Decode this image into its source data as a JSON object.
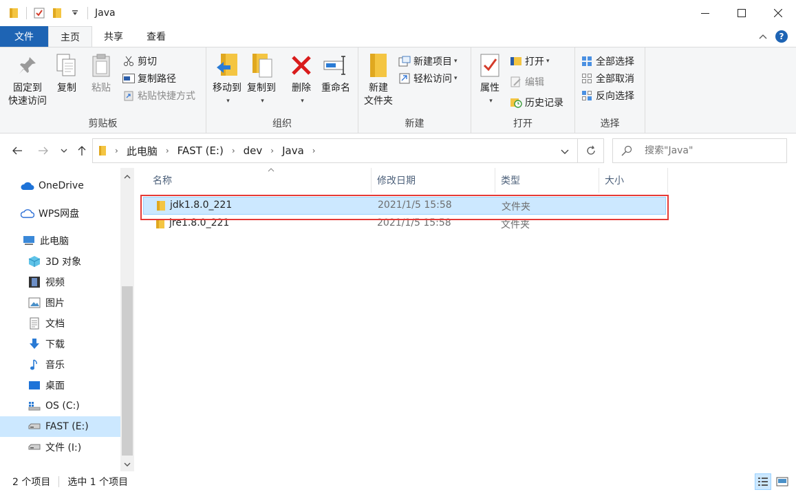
{
  "window": {
    "title": "Java"
  },
  "tabs": [
    {
      "label": "文件"
    },
    {
      "label": "主页"
    },
    {
      "label": "共享"
    },
    {
      "label": "查看"
    }
  ],
  "ribbon": {
    "clipboard": {
      "label": "剪贴板",
      "pin": "固定到\n快速访问",
      "copy": "复制",
      "paste": "粘贴",
      "cut": "剪切",
      "copy_path": "复制路径",
      "paste_shortcut": "粘贴快捷方式"
    },
    "organize": {
      "label": "组织",
      "move_to": "移动到",
      "copy_to": "复制到",
      "delete": "删除",
      "rename": "重命名"
    },
    "new": {
      "label": "新建",
      "new_folder": "新建\n文件夹",
      "new_item": "新建项目",
      "easy_access": "轻松访问"
    },
    "open": {
      "label": "打开",
      "properties": "属性",
      "open": "打开",
      "edit": "编辑",
      "history": "历史记录"
    },
    "select": {
      "label": "选择",
      "select_all": "全部选择",
      "select_none": "全部取消",
      "invert": "反向选择"
    }
  },
  "address": {
    "crumbs": [
      "此电脑",
      "FAST (E:)",
      "dev",
      "Java"
    ],
    "search_placeholder": "搜索\"Java\""
  },
  "nav": [
    {
      "label": "OneDrive",
      "icon": "cloud-icon"
    },
    {
      "label": "WPS网盘",
      "icon": "cloud-outline-icon"
    },
    {
      "label": "此电脑",
      "icon": "computer-icon"
    },
    {
      "label": "3D 对象",
      "icon": "cube-icon"
    },
    {
      "label": "视频",
      "icon": "film-icon"
    },
    {
      "label": "图片",
      "icon": "picture-icon"
    },
    {
      "label": "文档",
      "icon": "document-icon"
    },
    {
      "label": "下载",
      "icon": "download-icon"
    },
    {
      "label": "音乐",
      "icon": "music-icon"
    },
    {
      "label": "桌面",
      "icon": "desktop-icon"
    },
    {
      "label": "OS (C:)",
      "icon": "os-drive-icon"
    },
    {
      "label": "FAST (E:)",
      "icon": "drive-icon"
    },
    {
      "label": "文件 (I:)",
      "icon": "drive-icon"
    }
  ],
  "columns": {
    "name": "名称",
    "date": "修改日期",
    "type": "类型",
    "size": "大小"
  },
  "files": [
    {
      "name": "jdk1.8.0_221",
      "date": "2021/1/5 15:58",
      "type": "文件夹"
    },
    {
      "name": "jre1.8.0_221",
      "date": "2021/1/5 15:58",
      "type": "文件夹"
    }
  ],
  "status": {
    "count": "2 个项目",
    "selected": "选中 1 个项目"
  },
  "colors": {
    "accent": "#1e64b4",
    "selection": "#cce8ff",
    "highlight_box": "#e53935",
    "folder": "#f4c542"
  }
}
